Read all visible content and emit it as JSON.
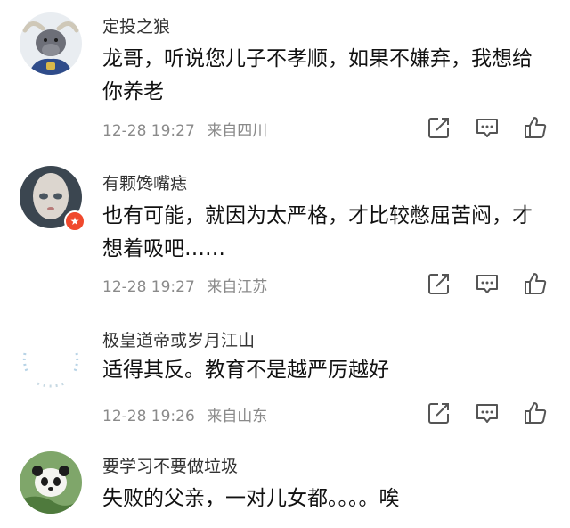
{
  "comments": [
    {
      "username": "定投之狼",
      "text": "龙哥，听说您儿子不孝顺，如果不嫌弃，我想给你养老",
      "time": "12-28 19:27",
      "location": "来自四川"
    },
    {
      "username": "有颗馋嘴痣",
      "text": "也有可能，就因为太严格，才比较憋屈苦闷，才想着吸吧……",
      "time": "12-28 19:27",
      "location": "来自江苏",
      "badge_icon": "star-badge-icon"
    },
    {
      "username": "极皇道帝或岁月江山",
      "text": "适得其反。教育不是越严厉越好",
      "time": "12-28 19:26",
      "location": "来自山东"
    },
    {
      "username": "要学习不要做垃圾",
      "text": "失败的父亲，一对儿女都。。。。唉"
    }
  ],
  "icons": {
    "share": "share-icon",
    "reply": "comment-icon",
    "like": "thumbs-up-icon"
  },
  "colors": {
    "meta_text": "#8a8a8a",
    "icon_stroke": "#555555",
    "badge": "#f0492d"
  }
}
